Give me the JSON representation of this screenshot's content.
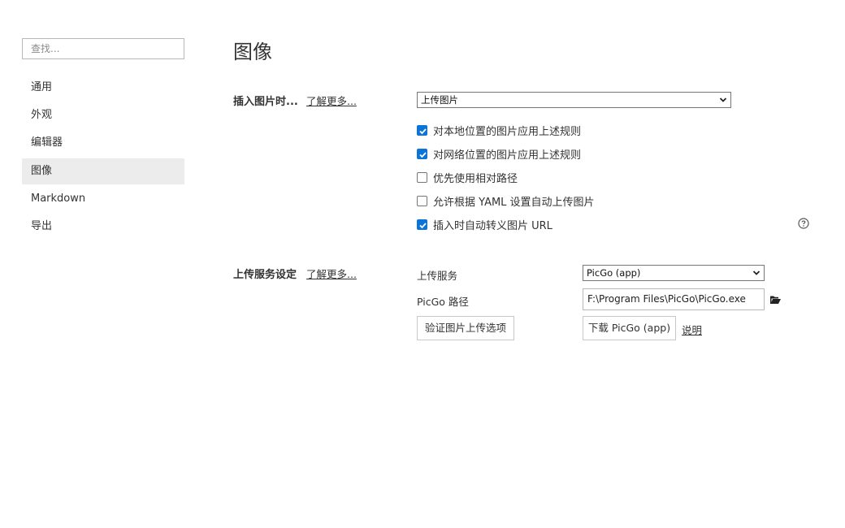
{
  "sidebar": {
    "search_placeholder": "查找...",
    "items": [
      {
        "label": "通用"
      },
      {
        "label": "外观"
      },
      {
        "label": "编辑器"
      },
      {
        "label": "图像"
      },
      {
        "label": "Markdown"
      },
      {
        "label": "导出"
      }
    ],
    "active_index": 3
  },
  "main": {
    "title": "图像",
    "insert_section": {
      "label": "插入图片时...",
      "learn_more": "了解更多...",
      "action_select": "上传图片",
      "options": [
        {
          "label": "对本地位置的图片应用上述规则",
          "checked": true
        },
        {
          "label": "对网络位置的图片应用上述规则",
          "checked": true
        },
        {
          "label": "优先使用相对路径",
          "checked": false
        },
        {
          "label": "允许根据 YAML 设置自动上传图片",
          "checked": false
        },
        {
          "label": "插入时自动转义图片 URL",
          "checked": true
        }
      ]
    },
    "upload_section": {
      "label": "上传服务设定",
      "learn_more": "了解更多...",
      "service_label": "上传服务",
      "service_value": "PicGo (app)",
      "path_label": "PicGo 路径",
      "path_value": "F:\\Program Files\\PicGo\\PicGo.exe",
      "verify_button": "验证图片上传选项",
      "download_button": "下载 PicGo (app)",
      "help_link": "说明"
    }
  },
  "icons": {
    "help": "question-circle-icon",
    "folder": "folder-open-icon",
    "caret": "chevron-down-icon"
  },
  "colors": {
    "accent": "#0a74d9",
    "active_nav_bg": "#ececec"
  }
}
